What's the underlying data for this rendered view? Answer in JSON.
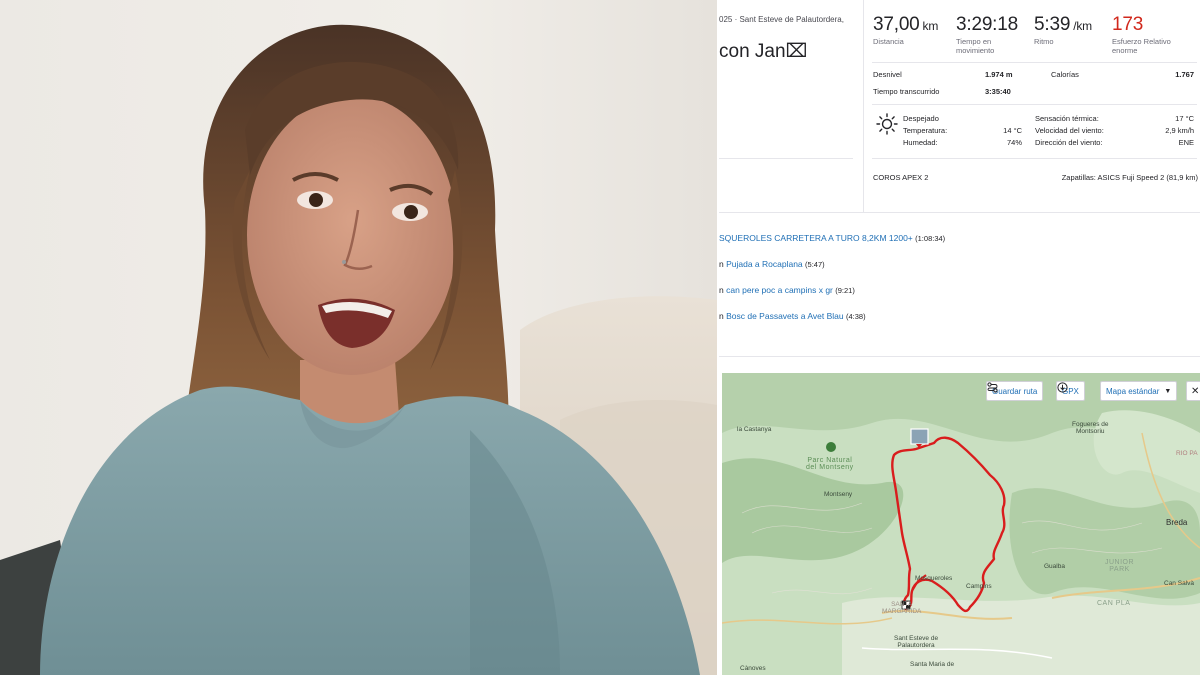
{
  "activity": {
    "date_location": "025 · Sant Esteve de Palautordera,",
    "title": "con Jan⌧"
  },
  "stats": {
    "distance": {
      "value": "37,00",
      "unit": "km",
      "label": "Distancia"
    },
    "moving_time": {
      "value": "3:29:18",
      "label": "Tiempo en movimiento"
    },
    "pace": {
      "value": "5:39",
      "unit": "/km",
      "label": "Ritmo"
    },
    "relative_effort": {
      "value": "173",
      "label": "Esfuerzo Relativo enorme",
      "color": "#d1281c"
    }
  },
  "details": {
    "elevation_label": "Desnivel",
    "elevation_value": "1.974 m",
    "calories_label": "Calorías",
    "calories_value": "1.767",
    "elapsed_label": "Tiempo transcurrido",
    "elapsed_value": "3:35:40"
  },
  "weather": {
    "icon": "sun-icon",
    "condition": "Despejado",
    "temp_label": "Temperatura:",
    "temp_value": "14 °C",
    "humidity_label": "Humedad:",
    "humidity_value": "74%",
    "feels_label": "Sensación térmica:",
    "feels_value": "17 °C",
    "wind_speed_label": "Velocidad del viento:",
    "wind_speed_value": "2,9 km/h",
    "wind_dir_label": "Dirección del viento:",
    "wind_dir_value": "ENE"
  },
  "gear": {
    "device": "COROS APEX 2",
    "shoes": "Zapatillas: ASICS Fuji Speed 2 (81,9 km)"
  },
  "segments": [
    {
      "prefix": "",
      "name": "SQUEROLES CARRETERA A TURO 8,2KM 1200+",
      "time": "(1:08:34)"
    },
    {
      "prefix": "n ",
      "name": "Pujada a Rocaplana",
      "time": "(5:47)"
    },
    {
      "prefix": "n ",
      "name": "can pere poc a campins x gr",
      "time": "(9:21)"
    },
    {
      "prefix": "n ",
      "name": "Bosc de Passavets a Avet Blau",
      "time": "(4:38)"
    }
  ],
  "map": {
    "save_route": "Guardar ruta",
    "gpx": "GPX",
    "map_type": "Mapa estándar",
    "labels": {
      "la_castanya": "la Castanya",
      "parc_natural": "Parc Natural\ndel Montseny",
      "montseny": "Montseny",
      "fogueres": "Fogueres de\nMontsoriu",
      "riopa": "RIO PA",
      "breda": "Breda",
      "gualba": "Gualba",
      "junior_park": "JUNIOR\nPARK",
      "can_salva": "Can Salvà",
      "can_pla": "CAN PLA",
      "mosqueroles": "Mosqueroles",
      "campins": "Campins",
      "santa_margarida": "SANTA\nMARGARIDA",
      "sant_esteve": "Sant Esteve de\nPalautordera",
      "santa_maria": "Santa Maria de",
      "canoves": "Cànoves"
    },
    "route_color": "#d91d1d"
  }
}
